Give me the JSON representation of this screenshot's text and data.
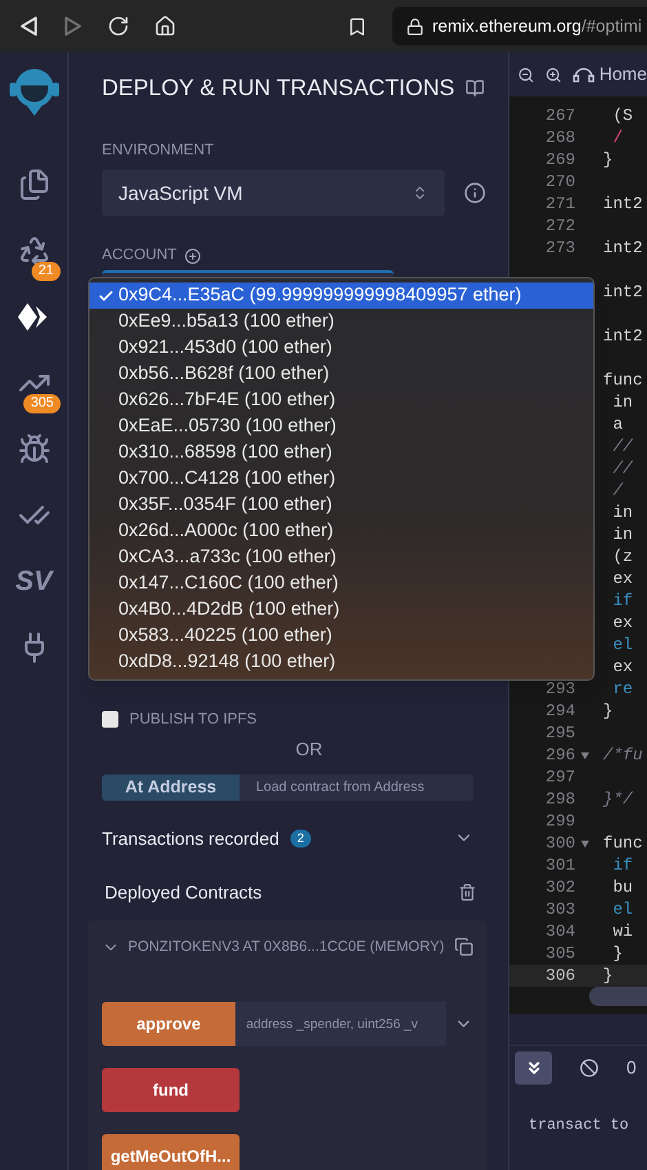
{
  "browser": {
    "url_host": "remix.ethereum.org",
    "url_path": "/#optimi"
  },
  "icon_bar": [
    {
      "kind": "files",
      "selected": false
    },
    {
      "kind": "compiler",
      "selected": false,
      "badge": "21"
    },
    {
      "kind": "deploy",
      "selected": true
    },
    {
      "kind": "analysis",
      "selected": false,
      "badge": "305"
    },
    {
      "kind": "debugger",
      "selected": false
    },
    {
      "kind": "tests",
      "selected": false
    },
    {
      "kind": "text",
      "label": "SV",
      "selected": false
    },
    {
      "kind": "plugins",
      "selected": false
    }
  ],
  "panel": {
    "title": "DEPLOY & RUN TRANSACTIONS",
    "environment": {
      "label": "ENVIRONMENT",
      "value": "JavaScript VM"
    },
    "account": {
      "label": "ACCOUNT",
      "options": [
        {
          "label": "0x9C4...E35aC (99.999999999998409957 ether)",
          "selected": true
        },
        {
          "label": "0xEe9...b5a13 (100 ether)",
          "selected": false
        },
        {
          "label": "0x921...453d0 (100 ether)",
          "selected": false
        },
        {
          "label": "0xb56...B628f (100 ether)",
          "selected": false
        },
        {
          "label": "0x626...7bF4E (100 ether)",
          "selected": false
        },
        {
          "label": "0xEaE...05730 (100 ether)",
          "selected": false
        },
        {
          "label": "0x310...68598 (100 ether)",
          "selected": false
        },
        {
          "label": "0x700...C4128 (100 ether)",
          "selected": false
        },
        {
          "label": "0x35F...0354F (100 ether)",
          "selected": false
        },
        {
          "label": "0x26d...A000c (100 ether)",
          "selected": false
        },
        {
          "label": "0xCA3...a733c (100 ether)",
          "selected": false
        },
        {
          "label": "0x147...C160C (100 ether)",
          "selected": false
        },
        {
          "label": "0x4B0...4D2dB (100 ether)",
          "selected": false
        },
        {
          "label": "0x583...40225 (100 ether)",
          "selected": false
        },
        {
          "label": "0xdD8...92148 (100 ether)",
          "selected": false
        }
      ]
    },
    "publish": {
      "label": "PUBLISH TO IPFS",
      "checked": false
    },
    "or": "OR",
    "at_address": {
      "button": "At Address",
      "placeholder": "Load contract from Address"
    },
    "transactions": {
      "label": "Transactions recorded",
      "count": "2",
      "expanded": false
    },
    "deployed": {
      "label": "Deployed Contracts",
      "contracts": [
        {
          "title": "PONZITOKENV3 AT 0X8B6...1CC0E (MEMORY)",
          "expanded": true,
          "functions": [
            {
              "name": "approve",
              "color": "#c56b38",
              "params_placeholder": "address _spender, uint256 _v"
            },
            {
              "name": "fund",
              "color": "#b5383d"
            },
            {
              "name": "getMeOutOfH...",
              "color": "#c56b38"
            }
          ]
        }
      ]
    }
  },
  "editor": {
    "tab": "Home",
    "lines": [
      {
        "number": "267",
        "code": " (S",
        "kind": "plain",
        "active": false
      },
      {
        "number": "268",
        "code": " /",
        "kind": "operator",
        "active": false
      },
      {
        "number": "269",
        "code": "}",
        "kind": "plain",
        "active": false
      },
      {
        "number": "270",
        "active": false
      },
      {
        "number": "271",
        "code": "int2",
        "kind": "plain",
        "active": false
      },
      {
        "number": "272",
        "active": false
      },
      {
        "number": "273",
        "code": "int2",
        "kind": "plain",
        "active": false
      },
      {
        "active": false
      },
      {
        "code": "int2",
        "kind": "plain",
        "active": false
      },
      {
        "active": false
      },
      {
        "code": "int2",
        "kind": "plain",
        "active": false
      },
      {
        "active": false
      },
      {
        "code": "func",
        "kind": "plain",
        "active": false
      },
      {
        "code": " in",
        "kind": "plain",
        "active": false
      },
      {
        "code": " a",
        "kind": "plain",
        "active": false
      },
      {
        "code": " //",
        "kind": "comment",
        "active": false
      },
      {
        "code": " //",
        "kind": "comment",
        "active": false
      },
      {
        "code": " /",
        "kind": "comment",
        "active": false
      },
      {
        "code": " in",
        "kind": "plain",
        "active": false
      },
      {
        "code": " in",
        "kind": "plain",
        "active": false
      },
      {
        "code": " (z",
        "kind": "plain",
        "active": false
      },
      {
        "code": " ex",
        "kind": "plain",
        "active": false
      },
      {
        "code": " if",
        "kind": "keyword",
        "active": false
      },
      {
        "code": " ex",
        "kind": "plain",
        "active": false
      },
      {
        "code": " el",
        "kind": "keyword",
        "active": false
      },
      {
        "code": " ex",
        "kind": "plain",
        "active": false
      },
      {
        "number": "293",
        "code": " re",
        "kind": "keyword",
        "active": false
      },
      {
        "number": "294",
        "code": "}",
        "kind": "plain",
        "active": false
      },
      {
        "number": "295",
        "active": false
      },
      {
        "number": "296",
        "code": "/*fu",
        "kind": "comment",
        "fold": true,
        "active": false
      },
      {
        "number": "297",
        "active": false
      },
      {
        "number": "298",
        "code": "}*/",
        "kind": "comment",
        "active": false
      },
      {
        "number": "299",
        "active": false
      },
      {
        "number": "300",
        "code": "func",
        "kind": "plain",
        "fold": true,
        "active": false
      },
      {
        "number": "301",
        "code": " if",
        "kind": "keyword",
        "active": false
      },
      {
        "number": "302",
        "code": " bu",
        "kind": "plain",
        "active": false
      },
      {
        "number": "303",
        "code": " el",
        "kind": "keyword",
        "active": false
      },
      {
        "number": "304",
        "code": " wi",
        "kind": "plain",
        "active": false
      },
      {
        "number": "305",
        "code": " }",
        "kind": "plain",
        "active": false
      },
      {
        "number": "306",
        "code": "}",
        "kind": "plain",
        "active": true
      }
    ],
    "terminal": {
      "count": "0",
      "text": "transact to"
    }
  }
}
